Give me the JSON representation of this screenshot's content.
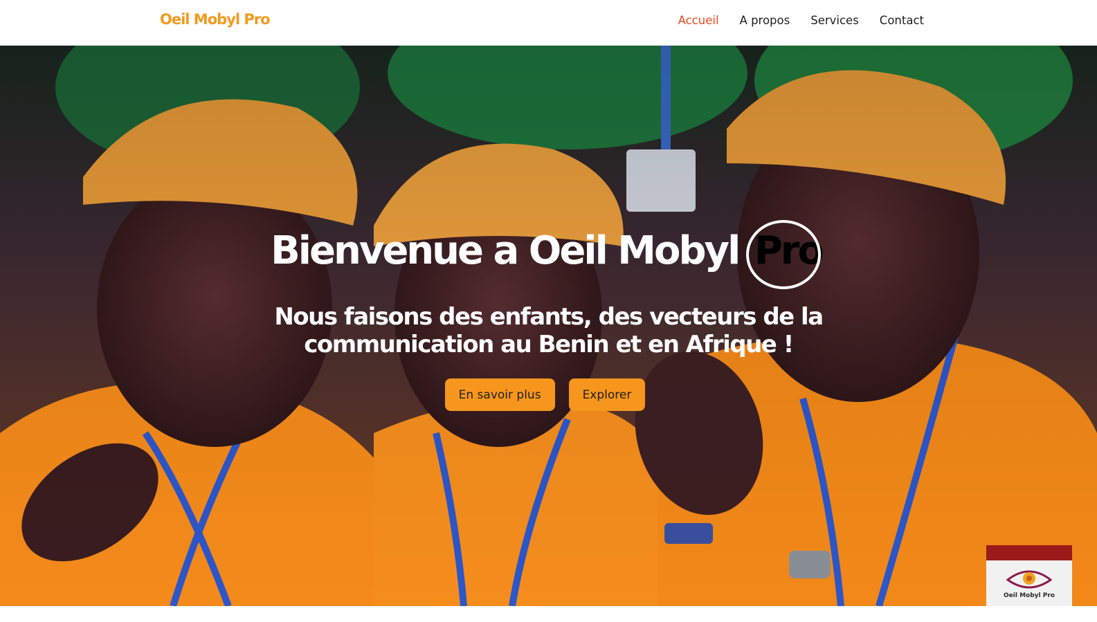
{
  "nav": {
    "brand": "Oeil Mobyl Pro",
    "links": [
      "Accueil",
      "A propos",
      "Services",
      "Contact"
    ],
    "active_index": 0,
    "accent_color": "#ea4b1c",
    "brand_color": "#f39a1e"
  },
  "hero": {
    "title_main": "Bienvenue a Oeil Mobyl ",
    "title_pro": "Pro",
    "subtitle_line1": "Nous faisons des enfants, des vecteurs de la",
    "subtitle_line2": "communication au Benin et en Afrique !",
    "buttons": [
      "En savoir plus",
      "Explorer"
    ],
    "button_color": "#f7961c",
    "background_image": "photo-children-in-orange-caps-clapping"
  },
  "widget": {
    "label": "Oeil Mobyl Pro",
    "icon": "eye-logo-icon"
  }
}
